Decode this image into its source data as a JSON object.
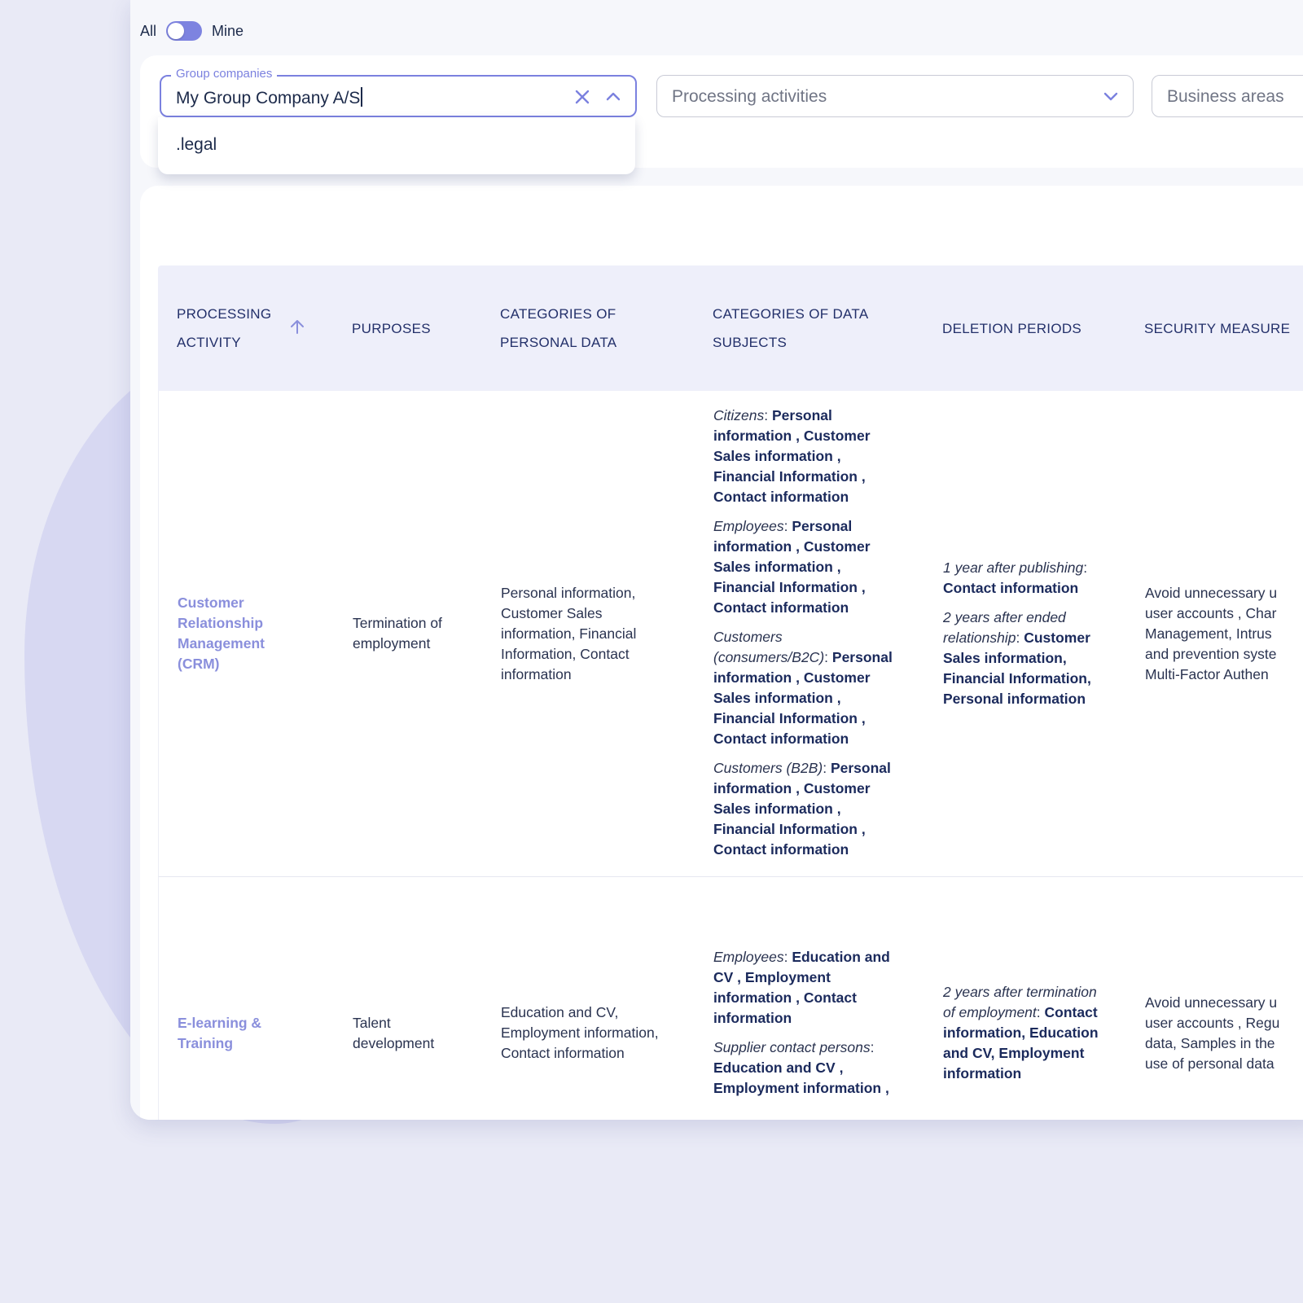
{
  "toggle": {
    "left_label": "All",
    "right_label": "Mine",
    "state": "Mine"
  },
  "filters": {
    "group_companies": {
      "label": "Group companies",
      "value": "My Group Company A/S",
      "options": [
        ".legal"
      ]
    },
    "processing_activities": {
      "placeholder": "Processing activities"
    },
    "business_areas": {
      "placeholder": "Business areas"
    }
  },
  "table": {
    "headers": {
      "activity_line1": "PROCESSING",
      "activity_line2": "ACTIVITY",
      "purposes": "PURPOSES",
      "categories_line1": "CATEGORIES OF",
      "categories_line2": "PERSONAL DATA",
      "subjects_line1": "CATEGORIES OF DATA",
      "subjects_line2": "SUBJECTS",
      "deletion": "DELETION PERIODS",
      "security": "SECURITY MEASURE"
    },
    "rows": [
      {
        "activity": [
          "Customer",
          "Relationship",
          "Management",
          "(CRM)"
        ],
        "purpose": [
          "Termination of",
          "employment"
        ],
        "categories": [
          "Personal information,",
          "Customer Sales",
          "information, Financial",
          "Information, Contact",
          "information"
        ],
        "subjects": [
          {
            "label": "Citizens",
            "l1": "Personal",
            "l2": "information , Customer",
            "l3": "Sales information ,",
            "l4": "Financial Information ,",
            "l5": "Contact information"
          },
          {
            "label": "Employees",
            "l1": "Personal",
            "l2": "information , Customer",
            "l3": "Sales information ,",
            "l4": "Financial Information ,",
            "l5": "Contact information"
          },
          {
            "label1": "Customers",
            "label2": "(consumers/B2C)",
            "l1": "Personal",
            "l2": "information , Customer",
            "l3": "Sales information ,",
            "l4": "Financial Information ,",
            "l5": "Contact information"
          },
          {
            "label": "Customers (B2B)",
            "l1": "Personal",
            "l2": "information , Customer",
            "l3": "Sales information ,",
            "l4": "Financial Information ,",
            "l5": "Contact information"
          }
        ],
        "deletion": [
          {
            "label": "1 year after publishing",
            "l1": "Contact information"
          },
          {
            "label1": "2 years after ended",
            "label2": "relationship",
            "l1": "Customer",
            "l2": "Sales information,",
            "l3": "Financial Information,",
            "l4": "Personal information"
          }
        ],
        "security": [
          "Avoid unnecessary u",
          "user accounts , Char",
          "Management, Intrus",
          "and prevention syste",
          "Multi-Factor Authen"
        ]
      },
      {
        "activity": [
          "E-learning &",
          "Training"
        ],
        "purpose": [
          "Talent",
          "development"
        ],
        "categories": [
          "Education and CV,",
          "Employment information,",
          "Contact information"
        ],
        "subjects": [
          {
            "label": "Employees",
            "l1": "Education and",
            "l2": "CV , Employment",
            "l3": "information , Contact",
            "l4": "information"
          },
          {
            "label": "Supplier contact persons",
            "l1": "Education and CV ,",
            "l2": "Employment information ,"
          }
        ],
        "deletion": [
          {
            "label1": "2 years after termination",
            "label2": "of employment",
            "l1": "Contact",
            "l2": "information, Education",
            "l3": "and CV, Employment",
            "l4": "information"
          }
        ],
        "security": [
          "Avoid unnecessary u",
          "user accounts , Regu",
          "data, Samples in the",
          "use of personal data"
        ]
      }
    ]
  }
}
